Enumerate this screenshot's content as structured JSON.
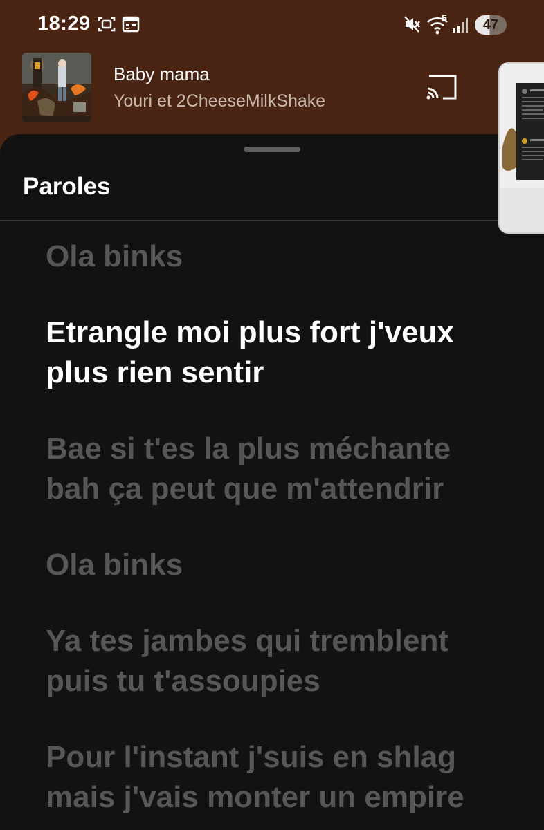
{
  "status_bar": {
    "time": "18:29",
    "battery": "47",
    "wifi_badge": "5"
  },
  "now_playing": {
    "title": "Baby mama",
    "artist": "Youri et 2CheeseMilkShake"
  },
  "lyrics_panel": {
    "title": "Paroles",
    "lines": [
      "Ola binks",
      "Etrangle moi plus fort j'veux plus rien sentir",
      "Bae si t'es la plus méchante bah ça peut que m'attendrir",
      "Ola binks",
      "Ya tes jambes qui tremblent puis tu t'assoupies",
      "Pour l'instant j'suis en shlag mais j'vais monter un empire"
    ],
    "active_line_index": 1
  },
  "colors": {
    "header_background": "#4a2412",
    "sheet_background": "#121212",
    "active_lyric": "#ffffff",
    "inactive_lyric": "#575757"
  }
}
